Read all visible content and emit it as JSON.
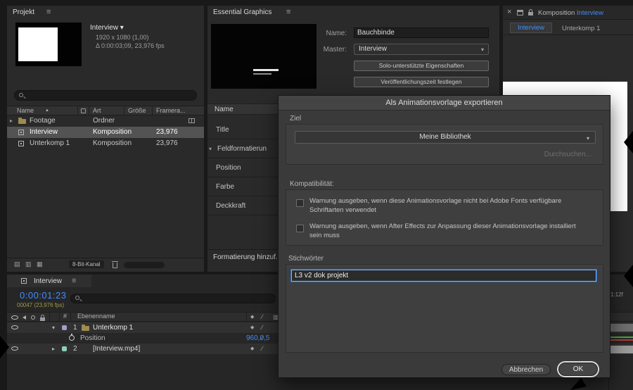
{
  "icons": {
    "menu": "≡",
    "close": "×",
    "sort": "▲",
    "expand": "▸",
    "open": "▾",
    "dropdown": "▾",
    "diamond": "◆",
    "slash": "∕",
    "grid": "▥",
    "footer1": "▤",
    "footer2": "▥",
    "footer3": "▦"
  },
  "project": {
    "title": "Projekt",
    "preview": {
      "name": "Interview ▾",
      "dimensions": "1920 x 1080 (1,00)",
      "duration": "Δ 0:00:03;09, 23,976 fps"
    },
    "columns": {
      "name": "Name",
      "art": "Art",
      "groesse": "Größe",
      "framerate": "Framera..."
    },
    "rows": [
      {
        "name": "Footage",
        "art": "Ordner",
        "framerate": ""
      },
      {
        "name": "Interview",
        "art": "Komposition",
        "framerate": "23,976"
      },
      {
        "name": "Unterkomp 1",
        "art": "Komposition",
        "framerate": "23,976"
      }
    ],
    "footer": {
      "bit_depth": "8-Bit-Kanal"
    }
  },
  "essential_graphics": {
    "title": "Essential Graphics",
    "name_label": "Name:",
    "name_value": "Bauchbinde",
    "master_label": "Master:",
    "master_value": "Interview",
    "solo_button": "Solo-unterstützte Eigenschaften",
    "publish_button": "Veröffentlichungszeit festlegen",
    "property_header": "Name",
    "properties": [
      "Title",
      "Feldformatierun",
      "Position",
      "Farbe",
      "Deckkraft"
    ],
    "footer_button": "Formatierung hinzuf..."
  },
  "viewer": {
    "tab_prefix": "Komposition",
    "tab_active": "Interview",
    "tabs": [
      "Interview",
      "Unterkomp 1"
    ]
  },
  "export_dialog": {
    "title": "Als Animationsvorlage exportieren",
    "target_label": "Ziel",
    "target_value": "Meine Bibliothek",
    "browse_button": "Durchsuchen...",
    "compatibility_label": "Kompatibilität:",
    "checkbox_fonts": "Warnung ausgeben, wenn diese Animationsvorlage nicht bei Adobe Fonts verfügbare Schriftarten verwendet",
    "checkbox_install": "Warnung ausgeben, wenn After Effects zur Anpassung dieser Animationsvorlage installiert sein muss",
    "keywords_label": "Stichwörter",
    "keywords_value": "L3 v2 dok projekt",
    "cancel_button": "Abbrechen",
    "ok_button": "OK"
  },
  "timeline": {
    "tab": "Interview",
    "timecode": "0:00:01:23",
    "frame_info": "00047 (23,976 fps)",
    "columns": {
      "number": "#",
      "name": "Ebenenname"
    },
    "layers": [
      {
        "number": "1",
        "name": "Unterkomp 1"
      },
      {
        "number": "2",
        "name": "[Interview.mp4]"
      }
    ],
    "property_row": {
      "label": "Position",
      "value": "960,0,5"
    },
    "ruler_label": "1:12f"
  }
}
